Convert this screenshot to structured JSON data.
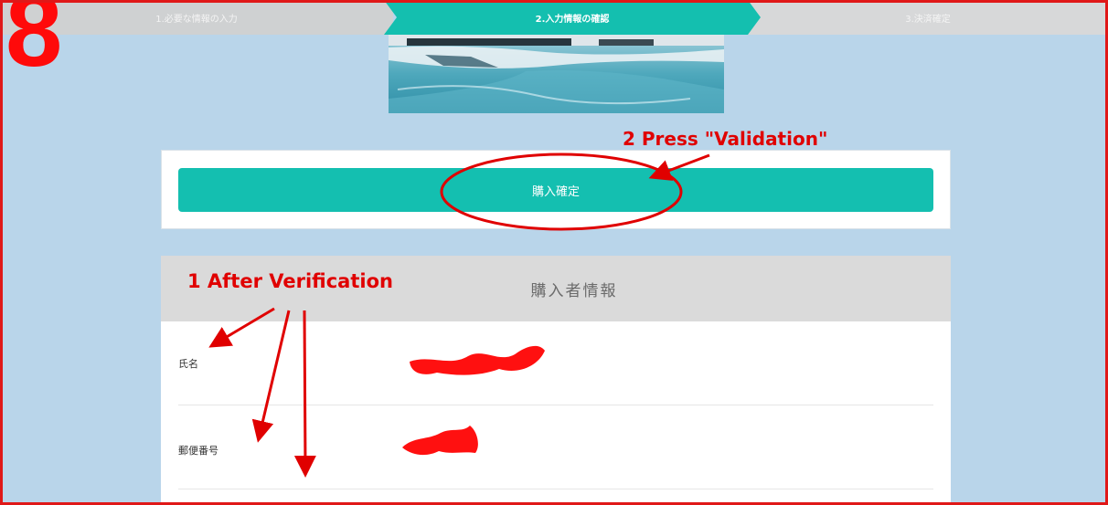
{
  "steps": [
    {
      "label": "1.必要な情報の入力",
      "state": "done"
    },
    {
      "label": "2.入力情報の確認",
      "state": "active"
    },
    {
      "label": "3.決済確定",
      "state": "pending"
    }
  ],
  "tutorial_step": "8",
  "confirm": {
    "button_label": "購入確定"
  },
  "buyer_info": {
    "title": "購入者情報",
    "fields": [
      {
        "label": "氏名",
        "value_state": "redacted"
      },
      {
        "label": "郵便番号",
        "value_state": "redacted"
      }
    ]
  },
  "annotations": {
    "press": "2 Press \"Validation\"",
    "verify": "1 After Verification"
  },
  "colors": {
    "accent": "#14bfb0",
    "page_bg": "#b9d5ea",
    "annotation": "#e00000"
  }
}
